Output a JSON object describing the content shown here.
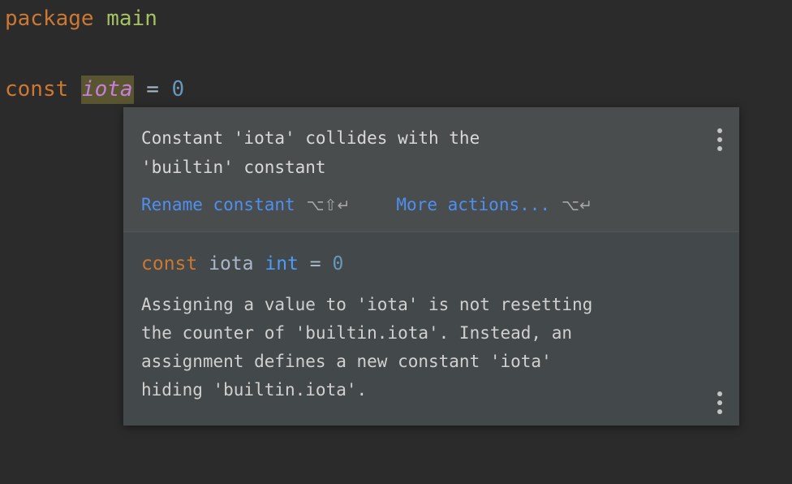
{
  "editor": {
    "background_color": "#2b2b2b",
    "lines": [
      {
        "tokens": [
          {
            "text": "package ",
            "kind": "keyword",
            "color": "#cc7832"
          },
          {
            "text": "main",
            "kind": "package-name",
            "color": "#a5c261"
          }
        ]
      },
      {
        "tokens": [
          {
            "text": "const ",
            "kind": "keyword",
            "color": "#cc7832"
          },
          {
            "text": "iota",
            "kind": "identifier-highlighted",
            "color": "#c77fdc",
            "highlight_color": "#5a5531"
          },
          {
            "text": " = ",
            "kind": "operator",
            "color": "#a9b7c6"
          },
          {
            "text": "0",
            "kind": "number",
            "color": "#6897bb"
          }
        ]
      }
    ],
    "line1": {
      "keyword": "package ",
      "name": "main"
    },
    "line2": {
      "keyword": "const ",
      "identifier": "iota",
      "operator": " = ",
      "number": "0"
    }
  },
  "popup": {
    "background_color": "#43484a",
    "header_background_color": "#4a4d4e",
    "link_color": "#4e8ff0",
    "header": {
      "message": "Constant 'iota' collides with the\n'builtin' constant",
      "actions": [
        {
          "label": "Rename constant",
          "shortcut": "⌥⇧↵"
        },
        {
          "label": "More actions...",
          "shortcut": "⌥↵"
        }
      ],
      "action_rename_label": "Rename constant",
      "action_rename_shortcut": "⌥⇧↵",
      "action_more_label": "More actions...",
      "action_more_shortcut": "⌥↵",
      "menu_icon": "kebab-menu-icon"
    },
    "body": {
      "signature": {
        "keyword": "const ",
        "name": "iota ",
        "type": "int",
        "operator": " = ",
        "value": "0"
      },
      "description": "Assigning a value to 'iota' is not resetting\nthe counter of 'builtin.iota'. Instead, an\nassignment defines a new constant 'iota'\nhiding 'builtin.iota'.",
      "menu_icon": "kebab-menu-icon"
    }
  }
}
